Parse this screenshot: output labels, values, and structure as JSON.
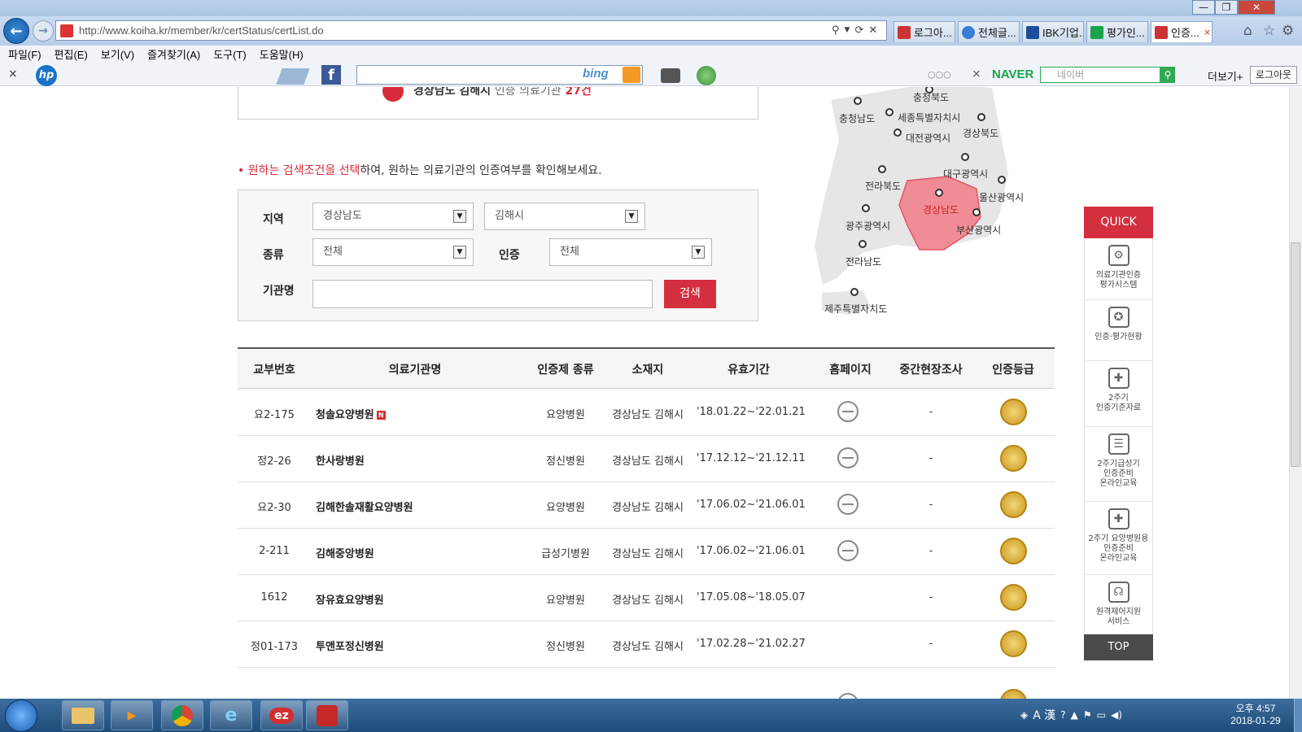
{
  "browser": {
    "url": "http://www.koiha.kr/member/kr/certStatus/certList.do",
    "tabs": [
      "로그아...",
      "전체글...",
      "IBK기업...",
      "평가인...",
      "인증..."
    ],
    "tab_close": "×",
    "menu": [
      "파일(F)",
      "편집(E)",
      "보기(V)",
      "즐겨찾기(A)",
      "도구(T)",
      "도움말(H)"
    ],
    "toolbar": {
      "close_label": "×",
      "bing_label": "bing",
      "naver_label": "NAVER",
      "naver_placeholder": "네이버",
      "more_label": "더보기+",
      "login_label": "로그아웃",
      "dots": "○○○",
      "naver_close": "×"
    }
  },
  "page": {
    "result_banner": {
      "region": "경상남도 김해시",
      "text": "인증 의료기관",
      "count": "27건"
    },
    "instruction": {
      "bullet": "•",
      "highlight": "원하는 검색조건을 선택",
      "rest": "하여, 원하는 의료기관의 인증여부를 확인해보세요."
    },
    "search": {
      "region_label": "지역",
      "region_value": "경상남도",
      "city_value": "김해시",
      "type_label": "종류",
      "type_value": "전체",
      "cert_label": "인증",
      "cert_value": "전체",
      "name_label": "기관명",
      "name_value": "",
      "search_button": "검색",
      "arrow": "▼"
    },
    "map": {
      "regions": [
        "충청북도",
        "충청남도",
        "세종특별자치시",
        "경상북도",
        "대전광역시",
        "대구광역시",
        "전라북도",
        "울산광역시",
        "경상남도",
        "광주광역시",
        "부산광역시",
        "전라남도",
        "제주특별자치도"
      ],
      "selected": "경상남도",
      "colors": {
        "land": "#e6e6e6",
        "selected": "#f08c96",
        "selected_stroke": "#e05565"
      }
    },
    "table": {
      "headers": [
        "교부번호",
        "의료기관명",
        "인증제 종류",
        "소재지",
        "유효기간",
        "홈페이지",
        "중간현장조사",
        "인증등급"
      ],
      "rows": [
        {
          "no": "요2-175",
          "name": "청솔요양병원",
          "new": "N",
          "type": "요양병원",
          "location": "경상남도 김해시",
          "period": "'18.01.22~'22.01.21",
          "homepage": true,
          "survey": "-"
        },
        {
          "no": "정2-26",
          "name": "한사랑병원",
          "new": "",
          "type": "정신병원",
          "location": "경상남도 김해시",
          "period": "'17.12.12~'21.12.11",
          "homepage": true,
          "survey": "-"
        },
        {
          "no": "요2-30",
          "name": "김해한솔재활요양병원",
          "new": "",
          "type": "요양병원",
          "location": "경상남도 김해시",
          "period": "'17.06.02~'21.06.01",
          "homepage": true,
          "survey": "-"
        },
        {
          "no": "2-211",
          "name": "김해중앙병원",
          "new": "",
          "type": "급성기병원",
          "location": "경상남도 김해시",
          "period": "'17.06.02~'21.06.01",
          "homepage": true,
          "survey": "-"
        },
        {
          "no": "1612",
          "name": "장유효요양병원",
          "new": "",
          "type": "요양병원",
          "location": "경상남도 김해시",
          "period": "'17.05.08~'18.05.07",
          "homepage": false,
          "survey": "-"
        },
        {
          "no": "정01-173",
          "name": "투앤포정신병원",
          "new": "",
          "type": "정신병원",
          "location": "경상남도 김해시",
          "period": "'17.02.28~'21.02.27",
          "homepage": false,
          "survey": "-"
        }
      ]
    },
    "quick": {
      "title": "QUICK",
      "items": [
        {
          "line1": "의료기관인증",
          "line2": "평가시스템",
          "line3": "",
          "icon": "monitor-gear-icon"
        },
        {
          "line1": "인증·평가현황",
          "line2": "",
          "line3": "",
          "icon": "award-ribbon-icon"
        },
        {
          "line1": "2주기",
          "line2": "인증기준자료",
          "line3": "",
          "icon": "document-plus-icon"
        },
        {
          "line1": "2주기급성기",
          "line2": "인증준비",
          "line3": "온라인교육",
          "icon": "clipboard-icon"
        },
        {
          "line1": "2주기 요양병원용",
          "line2": "인증준비",
          "line3": "온라인교육",
          "icon": "hospital-plus-icon"
        },
        {
          "line1": "원격제어지원",
          "line2": "서비스",
          "line3": "",
          "icon": "headset-icon"
        }
      ],
      "top_label": "TOP"
    }
  },
  "taskbar": {
    "ime": "A 漢",
    "time": "오후 4:57",
    "date": "2018-01-29"
  }
}
